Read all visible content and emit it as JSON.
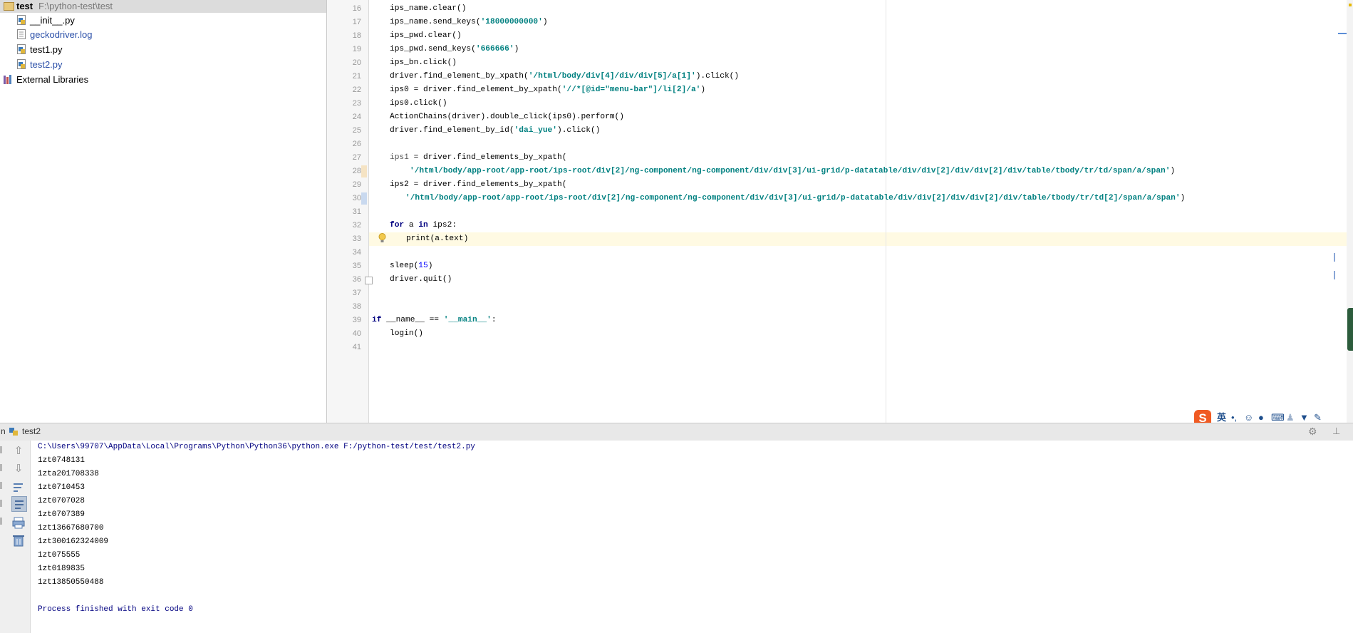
{
  "project": {
    "root_name": "test",
    "root_path": "F:\\python-test\\test",
    "files": [
      {
        "name": "__init__.py",
        "type": "python"
      },
      {
        "name": "geckodriver.log",
        "type": "log"
      },
      {
        "name": "test1.py",
        "type": "python"
      },
      {
        "name": "test2.py",
        "type": "python"
      }
    ],
    "external_libraries": "External Libraries"
  },
  "editor": {
    "line_numbers": [
      "16",
      "17",
      "18",
      "19",
      "20",
      "21",
      "22",
      "23",
      "24",
      "25",
      "26",
      "27",
      "28",
      "29",
      "30",
      "31",
      "32",
      "33",
      "34",
      "35",
      "36",
      "37",
      "38",
      "39",
      "40",
      "41"
    ],
    "current_line": "33"
  },
  "run": {
    "tab_prefix": "n",
    "tab_label": "test2",
    "command": "C:\\Users\\99707\\AppData\\Local\\Programs\\Python\\Python36\\python.exe F:/python-test/test/test2.py",
    "output_lines": [
      "1zt0748131",
      "1zta201708338",
      "1zt0710453",
      "1zt0707028",
      "1zt0707389",
      "1zt13667680700",
      "1zt300162324009",
      "1zt075555",
      "1zt0189835",
      "1zt13850550488"
    ],
    "exit_message": "Process finished with exit code 0"
  },
  "ime": {
    "lang_label": "英"
  },
  "colors": {
    "keyword": "#000080",
    "string": "#008080",
    "number": "#0000ff",
    "console_cmd": "#000080",
    "console_text": "#000000"
  }
}
